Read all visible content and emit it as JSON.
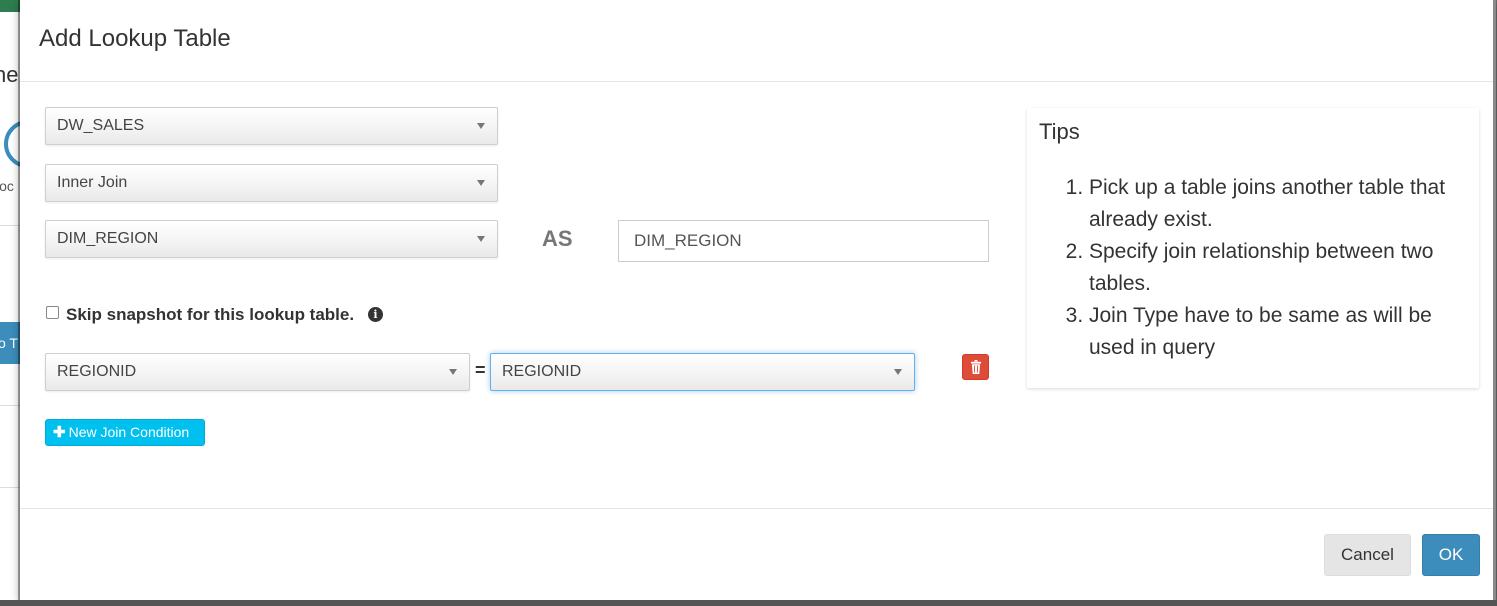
{
  "background": {
    "title_fragment": "he",
    "label_fragment": "loc",
    "button_fragment": "o T"
  },
  "modal": {
    "title": "Add Lookup Table",
    "fact_table": {
      "value": "DW_SALES"
    },
    "join_type": {
      "value": "Inner Join"
    },
    "lookup_table": {
      "value": "DIM_REGION"
    },
    "as_label": "AS",
    "alias": {
      "value": "DIM_REGION"
    },
    "skip_snapshot": {
      "checked": false,
      "label": "Skip snapshot for this lookup table."
    },
    "join_conditions": [
      {
        "left": "REGIONID",
        "operator": "=",
        "right": "REGIONID"
      }
    ],
    "new_join_label": "New Join Condition",
    "tips": {
      "title": "Tips",
      "items": [
        "Pick up a table joins another table that already exist.",
        "Specify join relationship between two tables.",
        "Join Type have to be same as will be used in query"
      ]
    },
    "footer": {
      "cancel_label": "Cancel",
      "ok_label": "OK"
    }
  },
  "colors": {
    "primary": "#3c8dbc",
    "danger": "#dd4b39",
    "info": "#00c0ef",
    "focus": "#66afe9"
  },
  "icons": {
    "info": "info-circle-icon",
    "delete": "trash-icon",
    "add": "plus-icon",
    "dropdown": "caret-down-icon"
  }
}
